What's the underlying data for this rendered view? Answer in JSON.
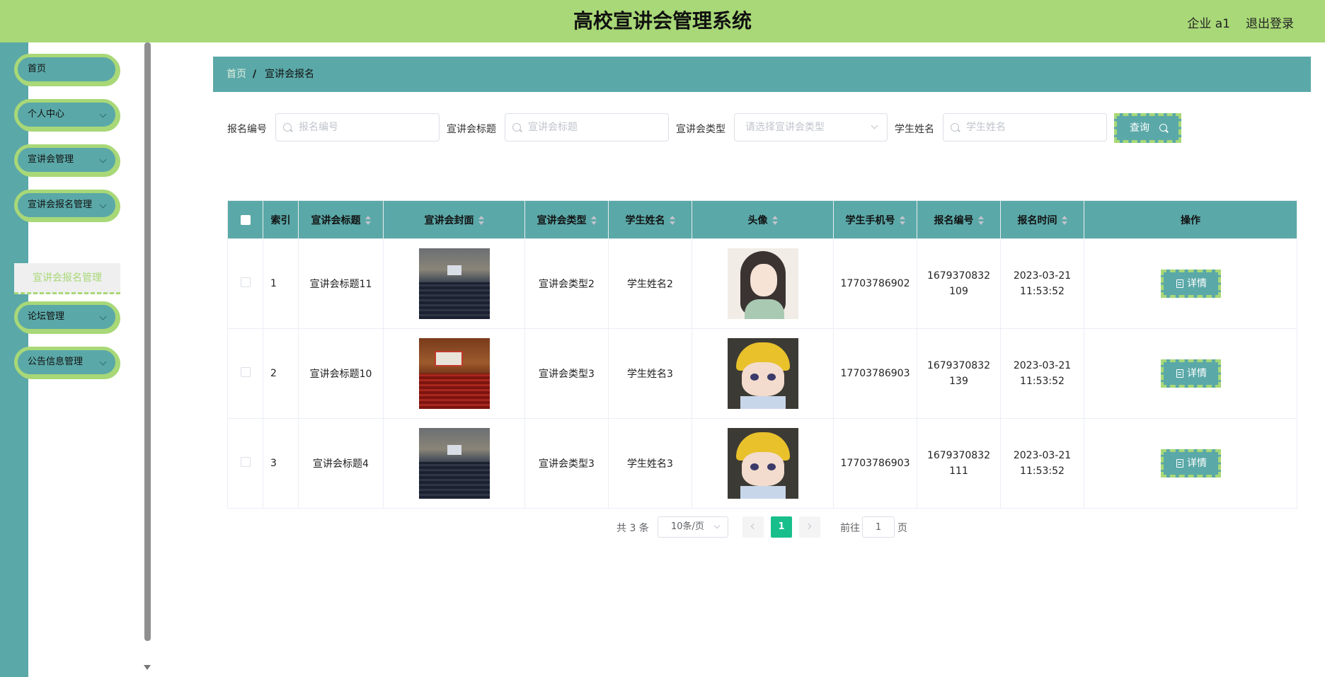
{
  "header": {
    "title": "高校宣讲会管理系统",
    "user": "企业 a1",
    "logout": "退出登录"
  },
  "sidebar": {
    "items": [
      {
        "label": "首页"
      },
      {
        "label": "个人中心"
      },
      {
        "label": "宣讲会管理"
      },
      {
        "label": "宣讲会报名管理"
      },
      {
        "label": "论坛管理"
      },
      {
        "label": "公告信息管理"
      }
    ],
    "active_sub": "宣讲会报名管理"
  },
  "breadcrumb": {
    "home": "首页",
    "separator": "/",
    "current": "宣讲会报名"
  },
  "search": {
    "f1_label": "报名编号",
    "f1_placeholder": "报名编号",
    "f2_label": "宣讲会标题",
    "f2_placeholder": "宣讲会标题",
    "f3_label": "宣讲会类型",
    "f3_placeholder": "请选择宣讲会类型",
    "f4_label": "学生姓名",
    "f4_placeholder": "学生姓名",
    "query": "查询"
  },
  "table": {
    "headers": [
      "索引",
      "宣讲会标题",
      "宣讲会封面",
      "宣讲会类型",
      "学生姓名",
      "头像",
      "学生手机号",
      "报名编号",
      "报名时间",
      "操作"
    ],
    "rows": [
      {
        "index": "1",
        "title": "宣讲会标题11",
        "type": "宣讲会类型2",
        "student": "学生姓名2",
        "phone": "17703786902",
        "reg_no": "1679370832109",
        "time": "2023-03-21 11:53:52",
        "action": "详情"
      },
      {
        "index": "2",
        "title": "宣讲会标题10",
        "type": "宣讲会类型3",
        "student": "学生姓名3",
        "phone": "17703786903",
        "reg_no": "1679370832139",
        "time": "2023-03-21 11:53:52",
        "action": "详情"
      },
      {
        "index": "3",
        "title": "宣讲会标题4",
        "type": "宣讲会类型3",
        "student": "学生姓名3",
        "phone": "17703786903",
        "reg_no": "1679370832111",
        "time": "2023-03-21 11:53:52",
        "action": "详情"
      }
    ]
  },
  "pagination": {
    "total": "共 3 条",
    "page_size": "10条/页",
    "current": "1",
    "goto": "前往",
    "goto_value": "1",
    "page": "页"
  },
  "colors": {
    "header": "#a8d877",
    "accent": "#5ba8a8",
    "active_page": "#19bf8b"
  }
}
